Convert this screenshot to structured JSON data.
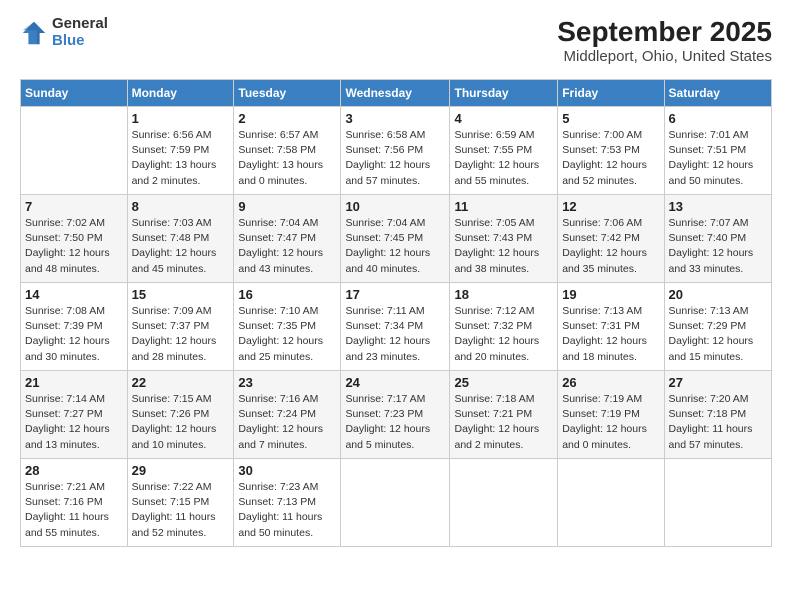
{
  "header": {
    "logo_line1": "General",
    "logo_line2": "Blue",
    "title": "September 2025",
    "subtitle": "Middleport, Ohio, United States"
  },
  "days_of_week": [
    "Sunday",
    "Monday",
    "Tuesday",
    "Wednesday",
    "Thursday",
    "Friday",
    "Saturday"
  ],
  "weeks": [
    [
      {
        "day": "",
        "content": ""
      },
      {
        "day": "1",
        "content": "Sunrise: 6:56 AM\nSunset: 7:59 PM\nDaylight: 13 hours\nand 2 minutes."
      },
      {
        "day": "2",
        "content": "Sunrise: 6:57 AM\nSunset: 7:58 PM\nDaylight: 13 hours\nand 0 minutes."
      },
      {
        "day": "3",
        "content": "Sunrise: 6:58 AM\nSunset: 7:56 PM\nDaylight: 12 hours\nand 57 minutes."
      },
      {
        "day": "4",
        "content": "Sunrise: 6:59 AM\nSunset: 7:55 PM\nDaylight: 12 hours\nand 55 minutes."
      },
      {
        "day": "5",
        "content": "Sunrise: 7:00 AM\nSunset: 7:53 PM\nDaylight: 12 hours\nand 52 minutes."
      },
      {
        "day": "6",
        "content": "Sunrise: 7:01 AM\nSunset: 7:51 PM\nDaylight: 12 hours\nand 50 minutes."
      }
    ],
    [
      {
        "day": "7",
        "content": "Sunrise: 7:02 AM\nSunset: 7:50 PM\nDaylight: 12 hours\nand 48 minutes."
      },
      {
        "day": "8",
        "content": "Sunrise: 7:03 AM\nSunset: 7:48 PM\nDaylight: 12 hours\nand 45 minutes."
      },
      {
        "day": "9",
        "content": "Sunrise: 7:04 AM\nSunset: 7:47 PM\nDaylight: 12 hours\nand 43 minutes."
      },
      {
        "day": "10",
        "content": "Sunrise: 7:04 AM\nSunset: 7:45 PM\nDaylight: 12 hours\nand 40 minutes."
      },
      {
        "day": "11",
        "content": "Sunrise: 7:05 AM\nSunset: 7:43 PM\nDaylight: 12 hours\nand 38 minutes."
      },
      {
        "day": "12",
        "content": "Sunrise: 7:06 AM\nSunset: 7:42 PM\nDaylight: 12 hours\nand 35 minutes."
      },
      {
        "day": "13",
        "content": "Sunrise: 7:07 AM\nSunset: 7:40 PM\nDaylight: 12 hours\nand 33 minutes."
      }
    ],
    [
      {
        "day": "14",
        "content": "Sunrise: 7:08 AM\nSunset: 7:39 PM\nDaylight: 12 hours\nand 30 minutes."
      },
      {
        "day": "15",
        "content": "Sunrise: 7:09 AM\nSunset: 7:37 PM\nDaylight: 12 hours\nand 28 minutes."
      },
      {
        "day": "16",
        "content": "Sunrise: 7:10 AM\nSunset: 7:35 PM\nDaylight: 12 hours\nand 25 minutes."
      },
      {
        "day": "17",
        "content": "Sunrise: 7:11 AM\nSunset: 7:34 PM\nDaylight: 12 hours\nand 23 minutes."
      },
      {
        "day": "18",
        "content": "Sunrise: 7:12 AM\nSunset: 7:32 PM\nDaylight: 12 hours\nand 20 minutes."
      },
      {
        "day": "19",
        "content": "Sunrise: 7:13 AM\nSunset: 7:31 PM\nDaylight: 12 hours\nand 18 minutes."
      },
      {
        "day": "20",
        "content": "Sunrise: 7:13 AM\nSunset: 7:29 PM\nDaylight: 12 hours\nand 15 minutes."
      }
    ],
    [
      {
        "day": "21",
        "content": "Sunrise: 7:14 AM\nSunset: 7:27 PM\nDaylight: 12 hours\nand 13 minutes."
      },
      {
        "day": "22",
        "content": "Sunrise: 7:15 AM\nSunset: 7:26 PM\nDaylight: 12 hours\nand 10 minutes."
      },
      {
        "day": "23",
        "content": "Sunrise: 7:16 AM\nSunset: 7:24 PM\nDaylight: 12 hours\nand 7 minutes."
      },
      {
        "day": "24",
        "content": "Sunrise: 7:17 AM\nSunset: 7:23 PM\nDaylight: 12 hours\nand 5 minutes."
      },
      {
        "day": "25",
        "content": "Sunrise: 7:18 AM\nSunset: 7:21 PM\nDaylight: 12 hours\nand 2 minutes."
      },
      {
        "day": "26",
        "content": "Sunrise: 7:19 AM\nSunset: 7:19 PM\nDaylight: 12 hours\nand 0 minutes."
      },
      {
        "day": "27",
        "content": "Sunrise: 7:20 AM\nSunset: 7:18 PM\nDaylight: 11 hours\nand 57 minutes."
      }
    ],
    [
      {
        "day": "28",
        "content": "Sunrise: 7:21 AM\nSunset: 7:16 PM\nDaylight: 11 hours\nand 55 minutes."
      },
      {
        "day": "29",
        "content": "Sunrise: 7:22 AM\nSunset: 7:15 PM\nDaylight: 11 hours\nand 52 minutes."
      },
      {
        "day": "30",
        "content": "Sunrise: 7:23 AM\nSunset: 7:13 PM\nDaylight: 11 hours\nand 50 minutes."
      },
      {
        "day": "",
        "content": ""
      },
      {
        "day": "",
        "content": ""
      },
      {
        "day": "",
        "content": ""
      },
      {
        "day": "",
        "content": ""
      }
    ]
  ]
}
